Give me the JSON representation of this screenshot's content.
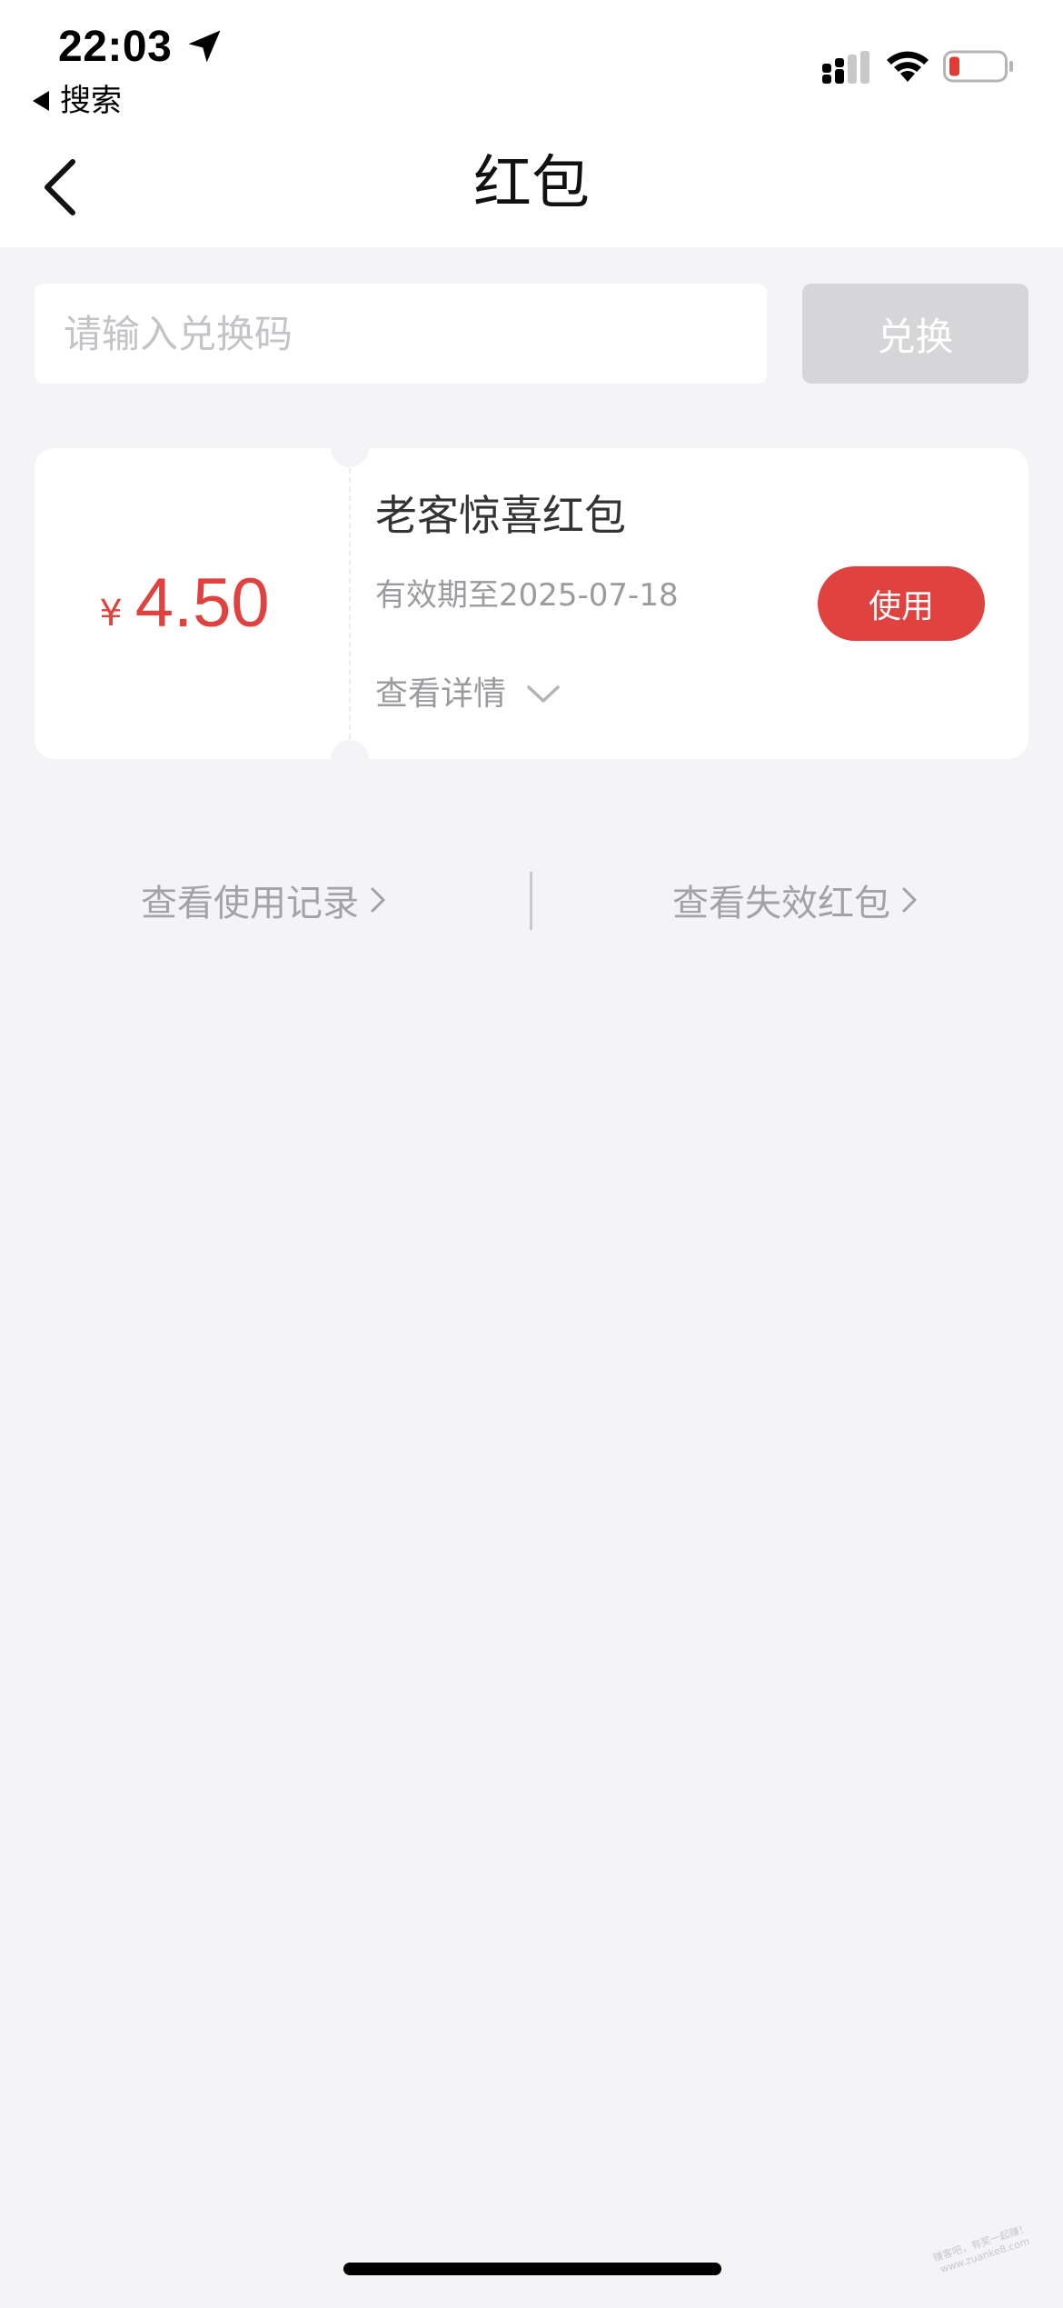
{
  "status_bar": {
    "time": "22:03",
    "back_app_label": "搜索"
  },
  "nav": {
    "title": "红包"
  },
  "redeem": {
    "placeholder": "请输入兑换码",
    "value": "",
    "button_label": "兑换"
  },
  "coupon": {
    "currency_symbol": "¥",
    "amount": "4.50",
    "title": "老客惊喜红包",
    "expiry": "有效期至2025-07-18",
    "details_label": "查看详情",
    "use_label": "使用"
  },
  "links": {
    "usage_history": "查看使用记录",
    "expired": "查看失效红包"
  },
  "watermark": {
    "line1": "赚客吧，有奖一起赚！",
    "line2": "www.zuanke8.com"
  },
  "colors": {
    "accent": "#e0423f",
    "background": "#f4f4f6",
    "disabled_button": "#d6d6d8"
  },
  "status": {
    "battery_level": 0.15,
    "battery_state": "low",
    "signal_bars_active": 2,
    "signal_bars_total": 4
  }
}
